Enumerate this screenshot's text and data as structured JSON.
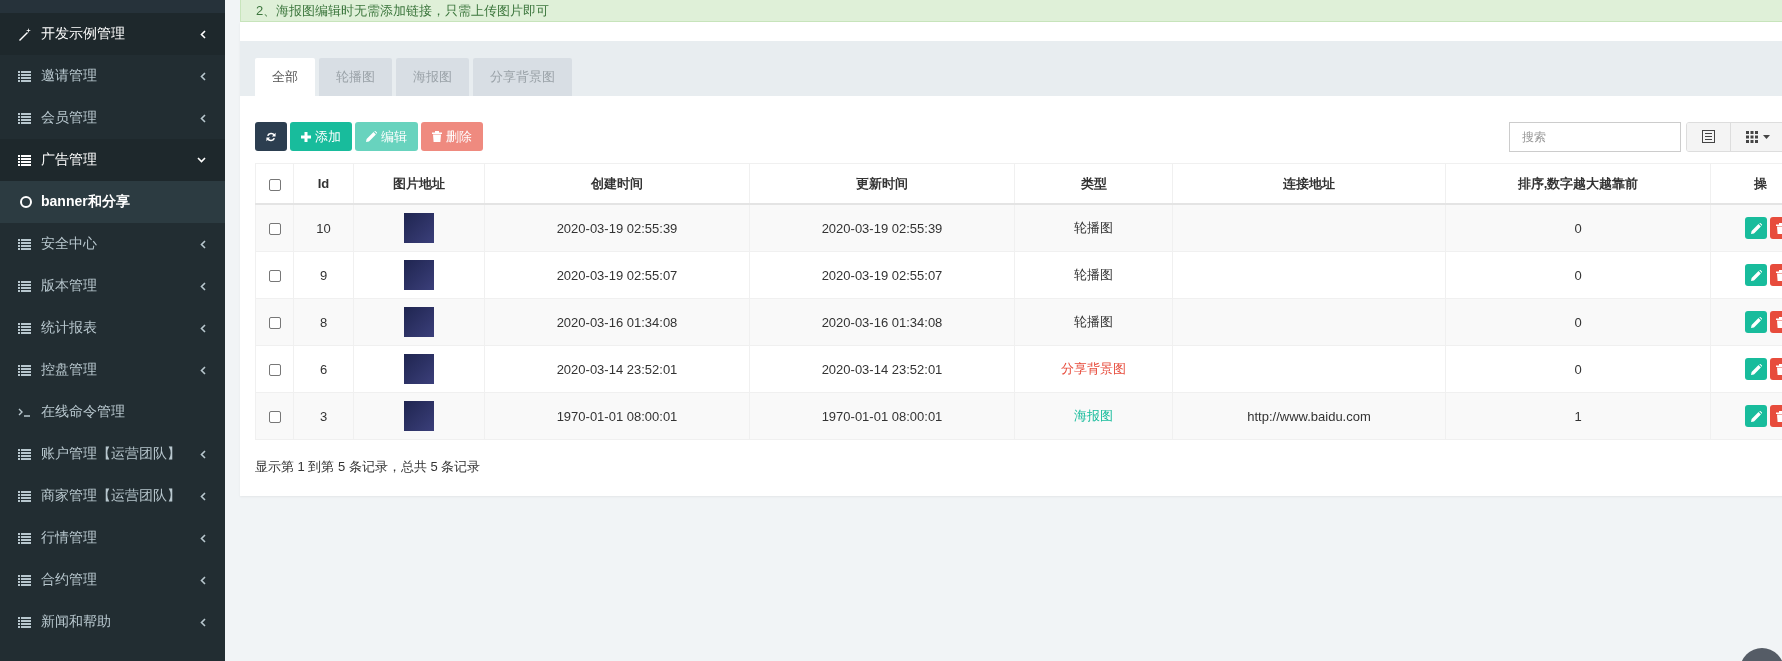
{
  "sidebar": {
    "items": [
      {
        "label": "开发示例管理",
        "kind": "tool",
        "active": true,
        "expanded": false
      },
      {
        "label": "邀请管理",
        "kind": "menu",
        "active": false,
        "expanded": false
      },
      {
        "label": "会员管理",
        "kind": "menu",
        "active": false,
        "expanded": false
      },
      {
        "label": "广告管理",
        "kind": "menu",
        "active": true,
        "expanded": true,
        "children": [
          {
            "label": "banner和分享",
            "selected": true
          }
        ]
      },
      {
        "label": "安全中心",
        "kind": "menu",
        "active": false,
        "expanded": false
      },
      {
        "label": "版本管理",
        "kind": "menu",
        "active": false,
        "expanded": false
      },
      {
        "label": "统计报表",
        "kind": "menu",
        "active": false,
        "expanded": false
      },
      {
        "label": "控盘管理",
        "kind": "menu",
        "active": false,
        "expanded": false
      },
      {
        "label": "在线命令管理",
        "kind": "command",
        "active": false
      },
      {
        "label": "账户管理【运营团队】",
        "kind": "menu",
        "active": false,
        "expanded": false
      },
      {
        "label": "商家管理【运营团队】",
        "kind": "menu",
        "active": false,
        "expanded": false
      },
      {
        "label": "行情管理",
        "kind": "menu",
        "active": false,
        "expanded": false
      },
      {
        "label": "合约管理",
        "kind": "menu",
        "active": false,
        "expanded": false
      },
      {
        "label": "新闻和帮助",
        "kind": "menu",
        "active": false,
        "expanded": false
      }
    ]
  },
  "alert": {
    "text": "2、海报图编辑时无需添加链接，只需上传图片即可"
  },
  "tabs": [
    {
      "label": "全部",
      "selected": true
    },
    {
      "label": "轮播图",
      "selected": false
    },
    {
      "label": "海报图",
      "selected": false
    },
    {
      "label": "分享背景图",
      "selected": false
    }
  ],
  "toolbar": {
    "buttons": [
      {
        "kind": "refresh",
        "disabled": false
      },
      {
        "kind": "add",
        "label": "添加",
        "disabled": false
      },
      {
        "kind": "edit",
        "label": "编辑",
        "disabled": true
      },
      {
        "kind": "delete",
        "label": "删除",
        "disabled": true
      }
    ],
    "search": {
      "placeholder": "搜索"
    }
  },
  "table": {
    "header_checked": false,
    "columns": [
      "Id",
      "图片地址",
      "创建时间",
      "更新时间",
      "类型",
      "连接地址",
      "排序,数字越大越靠前",
      "操"
    ],
    "rows": [
      {
        "checked": false,
        "id": "10",
        "created": "2020-03-19 02:55:39",
        "updated": "2020-03-19 02:55:39",
        "type": {
          "label": "轮播图",
          "color": "#333333"
        },
        "sort": "0"
      },
      {
        "checked": false,
        "id": "9",
        "created": "2020-03-19 02:55:07",
        "updated": "2020-03-19 02:55:07",
        "type": {
          "label": "轮播图",
          "color": "#333333"
        },
        "sort": "0"
      },
      {
        "checked": false,
        "id": "8",
        "created": "2020-03-16 01:34:08",
        "updated": "2020-03-16 01:34:08",
        "type": {
          "label": "轮播图",
          "color": "#333333"
        },
        "sort": "0"
      },
      {
        "checked": false,
        "id": "6",
        "created": "2020-03-14 23:52:01",
        "updated": "2020-03-14 23:52:01",
        "type": {
          "label": "分享背景图",
          "color": "#e74c3c"
        },
        "sort": "0"
      },
      {
        "checked": false,
        "id": "3",
        "created": "1970-01-01 08:00:01",
        "updated": "1970-01-01 08:00:01",
        "type": {
          "label": "海报图",
          "color": "#18bc9c"
        },
        "link": "http://www.baidu.com",
        "sort": "1"
      }
    ]
  },
  "pagination": {
    "summary": "显示第 1 到第 5 条记录，总共 5 条记录"
  }
}
